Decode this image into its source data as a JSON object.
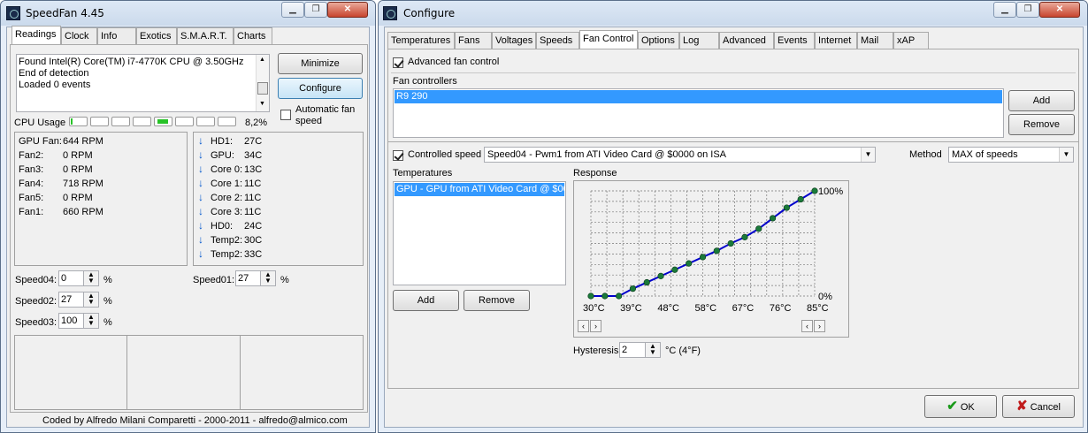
{
  "speedfan": {
    "title": "SpeedFan 4.45",
    "tabs": [
      "Readings",
      "Clock",
      "Info",
      "Exotics",
      "S.M.A.R.T.",
      "Charts"
    ],
    "log_lines": [
      "Found Intel(R) Core(TM) i7-4770K CPU @ 3.50GHz",
      "End of detection",
      "Loaded 0 events"
    ],
    "minimize_label": "Minimize",
    "configure_label": "Configure",
    "auto_fan_label_1": "Automatic fan",
    "auto_fan_label_2": "speed",
    "cpu_usage_label": "CPU Usage",
    "cpu_usage_value": "8,2%",
    "fans": [
      {
        "name": "GPU Fan:",
        "value": "644 RPM"
      },
      {
        "name": "Fan2:",
        "value": "0 RPM"
      },
      {
        "name": "Fan3:",
        "value": "0 RPM"
      },
      {
        "name": "Fan4:",
        "value": "718 RPM"
      },
      {
        "name": "Fan5:",
        "value": "0 RPM"
      },
      {
        "name": "Fan1:",
        "value": "660 RPM"
      }
    ],
    "temps": [
      {
        "name": "HD1:",
        "value": "27C"
      },
      {
        "name": "GPU:",
        "value": "34C"
      },
      {
        "name": "Core 0:",
        "value": "13C"
      },
      {
        "name": "Core 1:",
        "value": "11C"
      },
      {
        "name": "Core 2:",
        "value": "11C"
      },
      {
        "name": "Core 3:",
        "value": "11C"
      },
      {
        "name": "HD0:",
        "value": "24C"
      },
      {
        "name": "Temp2:",
        "value": "30C"
      },
      {
        "name": "Temp2:",
        "value": "33C"
      }
    ],
    "speeds": [
      {
        "name": "Speed04:",
        "value": "0",
        "unit": "%"
      },
      {
        "name": "Speed02:",
        "value": "27",
        "unit": "%"
      },
      {
        "name": "Speed03:",
        "value": "100",
        "unit": "%"
      },
      {
        "name": "Speed01:",
        "value": "27",
        "unit": "%"
      }
    ],
    "footer": "Coded by Alfredo Milani Comparetti - 2000-2011 - alfredo@almico.com"
  },
  "configure": {
    "title": "Configure",
    "tabs": [
      "Temperatures",
      "Fans",
      "Voltages",
      "Speeds",
      "Fan Control",
      "Options",
      "Log",
      "Advanced",
      "Events",
      "Internet",
      "Mail",
      "xAP"
    ],
    "advanced_fan_control_label": "Advanced fan control",
    "fan_controllers_label": "Fan controllers",
    "fan_controller_item": "R9 290",
    "add_label": "Add",
    "remove_label": "Remove",
    "controlled_speed_label": "Controlled speed",
    "controlled_speed_value": "Speed04 - Pwm1 from ATI Video Card @ $0000 on ISA",
    "method_label": "Method",
    "method_value": "MAX of speeds",
    "temperatures_label": "Temperatures",
    "temperature_item": "GPU - GPU from ATI Video Card @ $0000",
    "response_label": "Response",
    "hysteresis_label": "Hysteresis",
    "hysteresis_value": "2",
    "hysteresis_unit": "°C (4°F)",
    "ok_label": "OK",
    "cancel_label": "Cancel"
  },
  "chart_data": {
    "type": "line",
    "x": [
      30,
      34,
      38,
      42,
      46,
      50,
      54,
      58,
      62,
      66,
      70,
      74,
      78,
      82,
      86
    ],
    "values": [
      0,
      0,
      0,
      7,
      13,
      19,
      25,
      31,
      37,
      43,
      50,
      56,
      64,
      74,
      84,
      92,
      100
    ],
    "y_max_label": "100%",
    "y_min_label": "0%",
    "x_ticks": [
      "30°C",
      "39°C",
      "48°C",
      "58°C",
      "67°C",
      "76°C",
      "85°C"
    ],
    "ylim": [
      0,
      100
    ],
    "grid": true,
    "line_color": "#0000cc",
    "point_color": "#1a7a3a"
  },
  "colors": {
    "selection": "#3399ff",
    "accent": "#3c7fb1"
  }
}
